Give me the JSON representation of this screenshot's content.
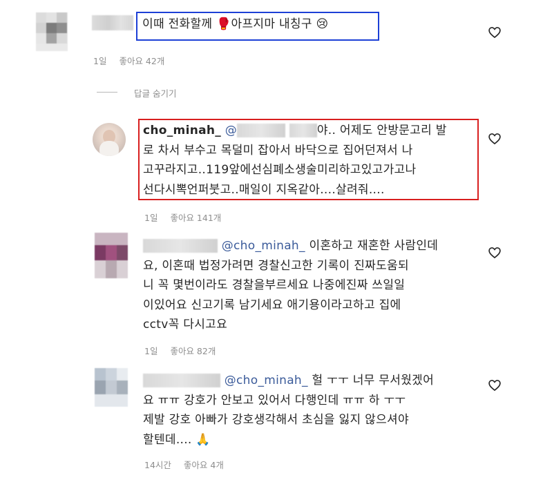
{
  "comments": [
    {
      "text": "이때 전화할께 🥊아프지마 내칭구 😢",
      "time": "1일",
      "likes": "좋아요 42개"
    }
  ],
  "hide_replies_label": "답글 숨기기",
  "replies": [
    {
      "username": "cho_minah_",
      "mention_prefix": "@",
      "line1_suffix": "야.. 어제도 안방문고리 발",
      "lines": [
        "로 차서 부수고 목덜미 잡아서 바닥으로 집어던져서 나",
        "고꾸라지고..119앞에선심폐소생술미리하고있고가고나",
        "선다시뽁언퍼붓고..매일이 지옥같아....살려줘...."
      ],
      "time": "1일",
      "likes": "좋아요 141개"
    },
    {
      "mention": "@cho_minah_",
      "line1_suffix": " 이혼하고 재혼한 사람인데",
      "lines": [
        "요, 이혼때 법정가려면 경찰신고한 기록이 진짜도움되",
        "니 꼭 몇번이라도 경찰을부르세요 나중에진짜 쓰일일",
        "이있어요 신고기록 남기세요 애기용이라고하고 집에",
        "cctv꼭 다시고요"
      ],
      "time": "1일",
      "likes": "좋아요 82개"
    },
    {
      "mention": "@cho_minah_",
      "line1_suffix": " 헐 ㅜㅜ 너무 무서웠겠어",
      "lines": [
        "요 ㅠㅠ 강호가 안보고 있어서 다행인데 ㅠㅠ 하 ㅜㅜ",
        "제발 강호 아빠가 강호생각해서 초심을 잃지 않으셔야",
        "할텐데.... 🙏"
      ],
      "time": "14시간",
      "likes": "좋아요 4개"
    }
  ],
  "icons": {
    "heart": "heart-outline-icon"
  },
  "colors": {
    "highlight_blue": "#1c3fd6",
    "highlight_red": "#d81e1e",
    "mention": "#3b5b9a",
    "meta": "#8e8e8e"
  }
}
